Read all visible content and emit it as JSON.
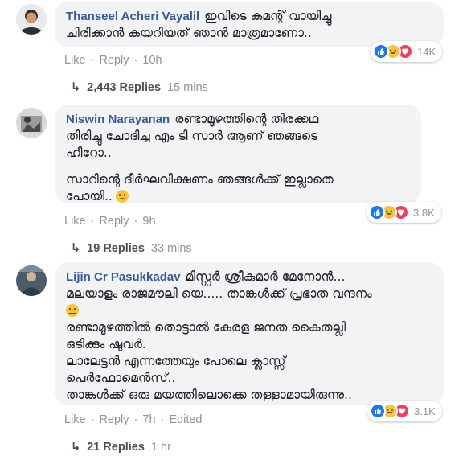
{
  "comments": [
    {
      "author": "Thanseel Acheri Vayalil",
      "lines": [
        "ഇവിടെ കമന്റ് വായിച്ചു",
        "ചിരിക്കാൻ കയറിയത് ഞാൻ മാത്രമാണോ.."
      ],
      "actions": {
        "like": "Like",
        "reply": "Reply",
        "time": "10h"
      },
      "reaction_count": "14K",
      "replies": {
        "label": "2,443 Replies",
        "time": "15 mins"
      }
    },
    {
      "author": "Niswin Narayanan",
      "lines": [
        "രണ്ടാമൂഴത്തിന്റെ തിരക്കഥ",
        "തിരിച്ചു ചോദിച്ച എം ടി സാർ ആണ് ഞങ്ങടെ",
        "ഹീറോ..",
        "സാറിന്റെ ദീർഘവീക്ഷണം ഞങ്ങൾക്ക് ഇല്ലാതെ",
        "പോയി.."
      ],
      "actions": {
        "like": "Like",
        "reply": "Reply",
        "time": "9h"
      },
      "reaction_count": "3.8K",
      "replies": {
        "label": "19 Replies",
        "time": "33 mins"
      }
    },
    {
      "author": "Lijin Cr Pasukkadav",
      "lines": [
        "മിസ്റ്റർ ശ്രീകുമാർ മേനോൻ...",
        "മലയാളം രാജമൗലി യെ..... താങ്കൾക്ക് പ്രഭാത വന്ദനം",
        "",
        "രണ്ടാമൂഴത്തിൽ തൊട്ടാൽ കേരള ജനത കൈതല്ലി",
        "ഒടിക്കും ഷുവർ.",
        "ലാലേട്ടൻ എന്നത്തേയും പോലെ ക്ലാസ്സ്",
        "പെർഫോമെൻസ്..",
        "താങ്കൾക്ക് ഒരു മയത്തിലൊക്കെ തള്ളാമായിരുന്നു.."
      ],
      "actions": {
        "like": "Like",
        "reply": "Reply",
        "time": "7h",
        "edited": "Edited"
      },
      "reaction_count": "3.1K",
      "replies": {
        "label": "21 Replies",
        "time": "1 hr"
      }
    }
  ],
  "icons": {
    "reply_arrow": "↳",
    "like": "like-reaction",
    "haha": "haha-reaction",
    "love": "love-reaction"
  },
  "colors": {
    "author": "#385898",
    "bubble": "#f2f3f5",
    "muted": "#8d949e",
    "like_blue": "#1877f2",
    "haha_yellow": "#f7c43a",
    "love_red": "#f33e58"
  }
}
